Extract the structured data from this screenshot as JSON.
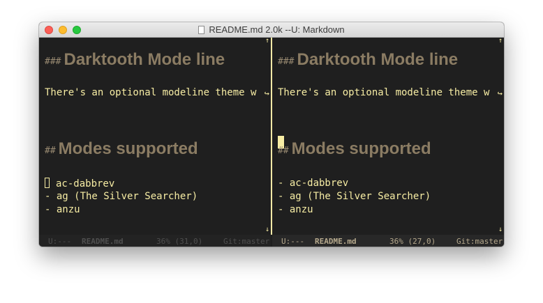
{
  "window": {
    "title": "README.md 2.0k --U: Markdown"
  },
  "left_pane": {
    "heading1": {
      "hashes": "###",
      "text": "Darktooth Mode line"
    },
    "line1": "There's an optional modeline theme w",
    "heading2": {
      "hashes": "##",
      "text": "Modes supported"
    },
    "items": [
      "ac-dabbrev",
      "- ag (The Silver Searcher)",
      "- anzu"
    ],
    "modeline": {
      "state": "U:---",
      "buffer": "README.md",
      "position": "36% (31,0)",
      "vc": "Git:master"
    }
  },
  "right_pane": {
    "heading1": {
      "hashes": "###",
      "text": "Darktooth Mode line"
    },
    "line1": "There's an optional modeline theme w",
    "heading2": {
      "hashes": "##",
      "text": "Modes supported"
    },
    "items": [
      "- ac-dabbrev",
      "- ag (The Silver Searcher)",
      "- anzu"
    ],
    "modeline": {
      "state": "U:---",
      "buffer": "README.md",
      "position": "36% (27,0)",
      "vc": "Git:master"
    }
  },
  "colors": {
    "background": "#1f1f1f",
    "foreground": "#f7eda4",
    "heading": "#8b7c63"
  }
}
